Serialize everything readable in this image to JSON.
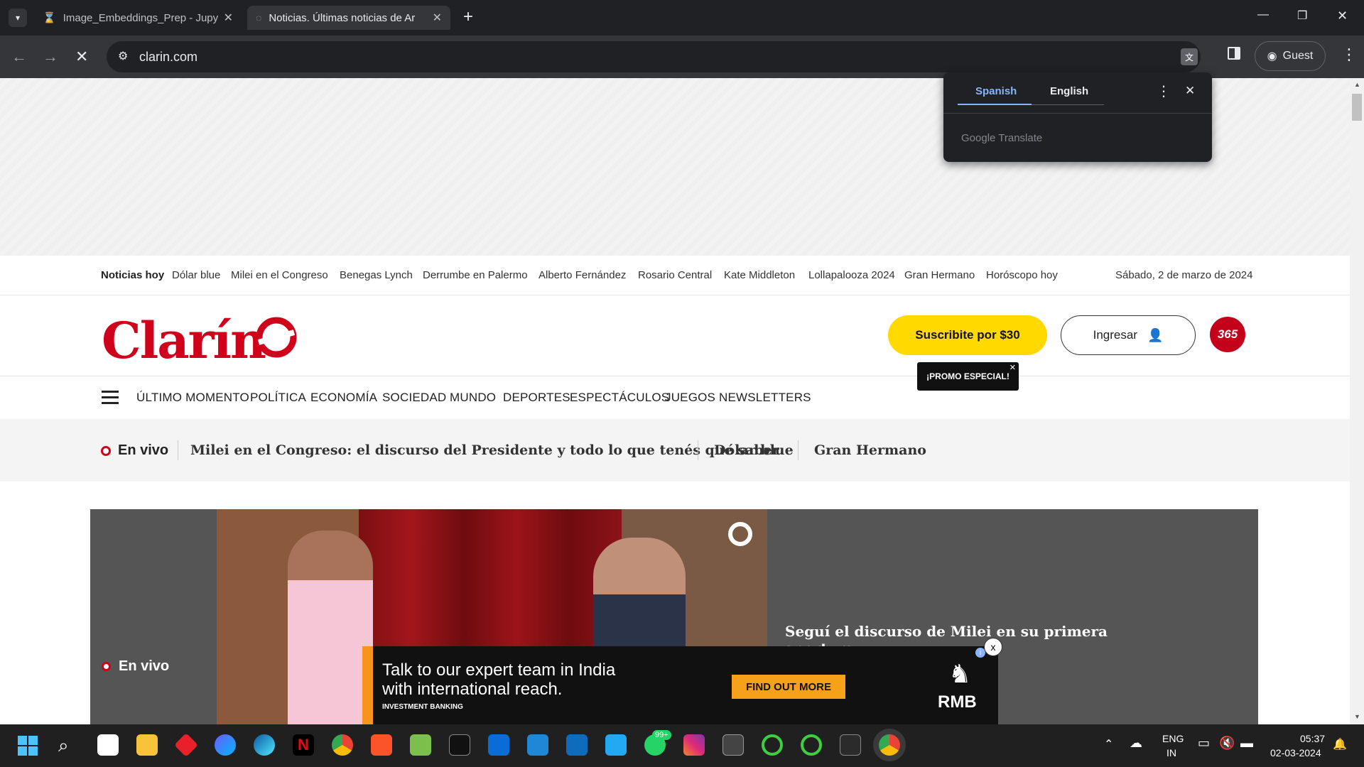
{
  "browser": {
    "tabs": [
      {
        "title": "Image_Embeddings_Prep - Jupy",
        "active": false
      },
      {
        "title": "Noticias. Últimas noticias de Ar",
        "active": true
      }
    ],
    "new_tab": "+",
    "url": "clarin.com",
    "profile": "Guest"
  },
  "translate_popup": {
    "source_lang": "Spanish",
    "target_lang": "English",
    "brand": "Google Translate"
  },
  "topics_bar": {
    "label": "Noticias hoy",
    "items": [
      "Dólar blue",
      "Milei en el Congreso",
      "Benegas Lynch",
      "Derrumbe en Palermo",
      "Alberto Fernández",
      "Rosario Central",
      "Kate Middleton",
      "Lollapalooza 2024",
      "Gran Hermano",
      "Horóscopo hoy"
    ],
    "date": "Sábado, 2 de marzo de 2024"
  },
  "header": {
    "logo": "Clarín",
    "subscribe": "Suscribite por $30",
    "promo": "¡PROMO ESPECIAL!",
    "login": "Ingresar",
    "badge": "365"
  },
  "nav": {
    "items": [
      "ÚLTIMO MOMENTO",
      "POLÍTICA",
      "ECONOMÍA",
      "SOCIEDAD",
      "MUNDO",
      "DEPORTES",
      "ESPECTÁCULOS",
      "JUEGOS",
      "NEWSLETTERS"
    ]
  },
  "live_strip": {
    "label": "En vivo",
    "links": [
      "Milei en el Congreso: el discurso del Presidente y todo lo que tenés que saber",
      "Dólar blue",
      "Gran Hermano"
    ]
  },
  "hero": {
    "label": "En vivo",
    "title": "Seguí el discurso de Milei en su primera apertura"
  },
  "ad": {
    "headline_1": "Talk to our expert team in India",
    "headline_2": "with international reach.",
    "small": "INVESTMENT BANKING",
    "cta": "FIND OUT MORE",
    "brand": "RMB",
    "close": "x"
  },
  "taskbar": {
    "lang_1": "ENG",
    "lang_2": "IN",
    "time": "05:37",
    "date": "02-03-2024",
    "badge": "99+"
  },
  "colors": {
    "accent_red": "#d0021b",
    "subscribe_yellow": "#ffd900",
    "chrome_dark": "#202124"
  }
}
